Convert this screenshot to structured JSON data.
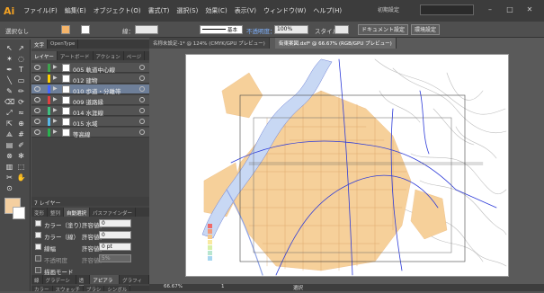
{
  "app": {
    "logo": "Ai",
    "workspace": "初期設定"
  },
  "menu": [
    "ファイル(F)",
    "編集(E)",
    "オブジェクト(O)",
    "書式(T)",
    "選択(S)",
    "効果(C)",
    "表示(V)",
    "ウィンドウ(W)",
    "ヘルプ(H)"
  ],
  "control": {
    "selection": "選択なし",
    "stroke_label": "線：",
    "stroke_style": "基本",
    "opacity_label": "不透明度：",
    "opacity_value": "100%",
    "style_label": "スタイル：",
    "doc_settings": "ドキュメント設定",
    "preferences": "環境設定"
  },
  "panel_tabs_top": [
    "文字",
    "OpenType"
  ],
  "panel_tabs_layers": [
    "レイヤー",
    "アートボード",
    "アクション",
    "ページ"
  ],
  "layers": [
    {
      "name": "005 軌道中心線",
      "color": "#3fa34d"
    },
    {
      "name": "012 建物",
      "color": "#ffd000"
    },
    {
      "name": "010 歩道・分離帯",
      "color": "#4466ff",
      "selected": true
    },
    {
      "name": "009 道路縁",
      "color": "#e04040"
    },
    {
      "name": "014 水涯線",
      "color": "#3fbf7f"
    },
    {
      "name": "015 水域",
      "color": "#58b8e8"
    },
    {
      "name": "等高線",
      "color": "#29b34f"
    }
  ],
  "layers_footer": "7 レイヤー",
  "trace_tabs": [
    "変形",
    "整列",
    "自動選択",
    "パスファインダー"
  ],
  "trace": {
    "fill_label": "カラー（塗り）",
    "stroke_label": "カラー（線）",
    "width_label": "線幅",
    "tol_label": "許容値：",
    "fill_tol": "0",
    "stroke_tol": "0",
    "width_tol": "0 pt",
    "opacity_label": "不透明度",
    "opacity_tol": "5%",
    "blend_label": "描画モード"
  },
  "bottom_tabs": [
    "カラー",
    "スウォッチ",
    "ブラシ",
    "シンボル"
  ],
  "bottom_tabs2": [
    "線",
    "グラデーション",
    "透明",
    "アピアランス",
    "グラフィック"
  ],
  "docs": [
    "名称未設定-1* @ 124% (CMYK/GPU プレビュー)",
    "街東案図.dxf* @ 66.67% (RGB/GPU プレビュー)"
  ],
  "status": {
    "zoom": "66.67%",
    "page": "1",
    "selection": "選択"
  },
  "colors": {
    "accent": "#4a7fbf",
    "selected_layer": "#6e7f99"
  },
  "icons": [
    "selection-icon",
    "direct-selection-icon",
    "magic-wand-icon",
    "lasso-icon",
    "pen-icon",
    "type-icon",
    "line-icon",
    "rectangle-icon",
    "brush-icon",
    "pencil-icon",
    "eraser-icon",
    "rotate-icon",
    "scale-icon",
    "warp-icon",
    "free-transform-icon",
    "shape-builder-icon",
    "perspective-icon",
    "mesh-icon",
    "gradient-icon",
    "eyedropper-icon",
    "blend-icon",
    "symbol-sprayer-icon",
    "graph-icon",
    "artboard-icon",
    "slice-icon",
    "hand-icon",
    "zoom-icon"
  ]
}
